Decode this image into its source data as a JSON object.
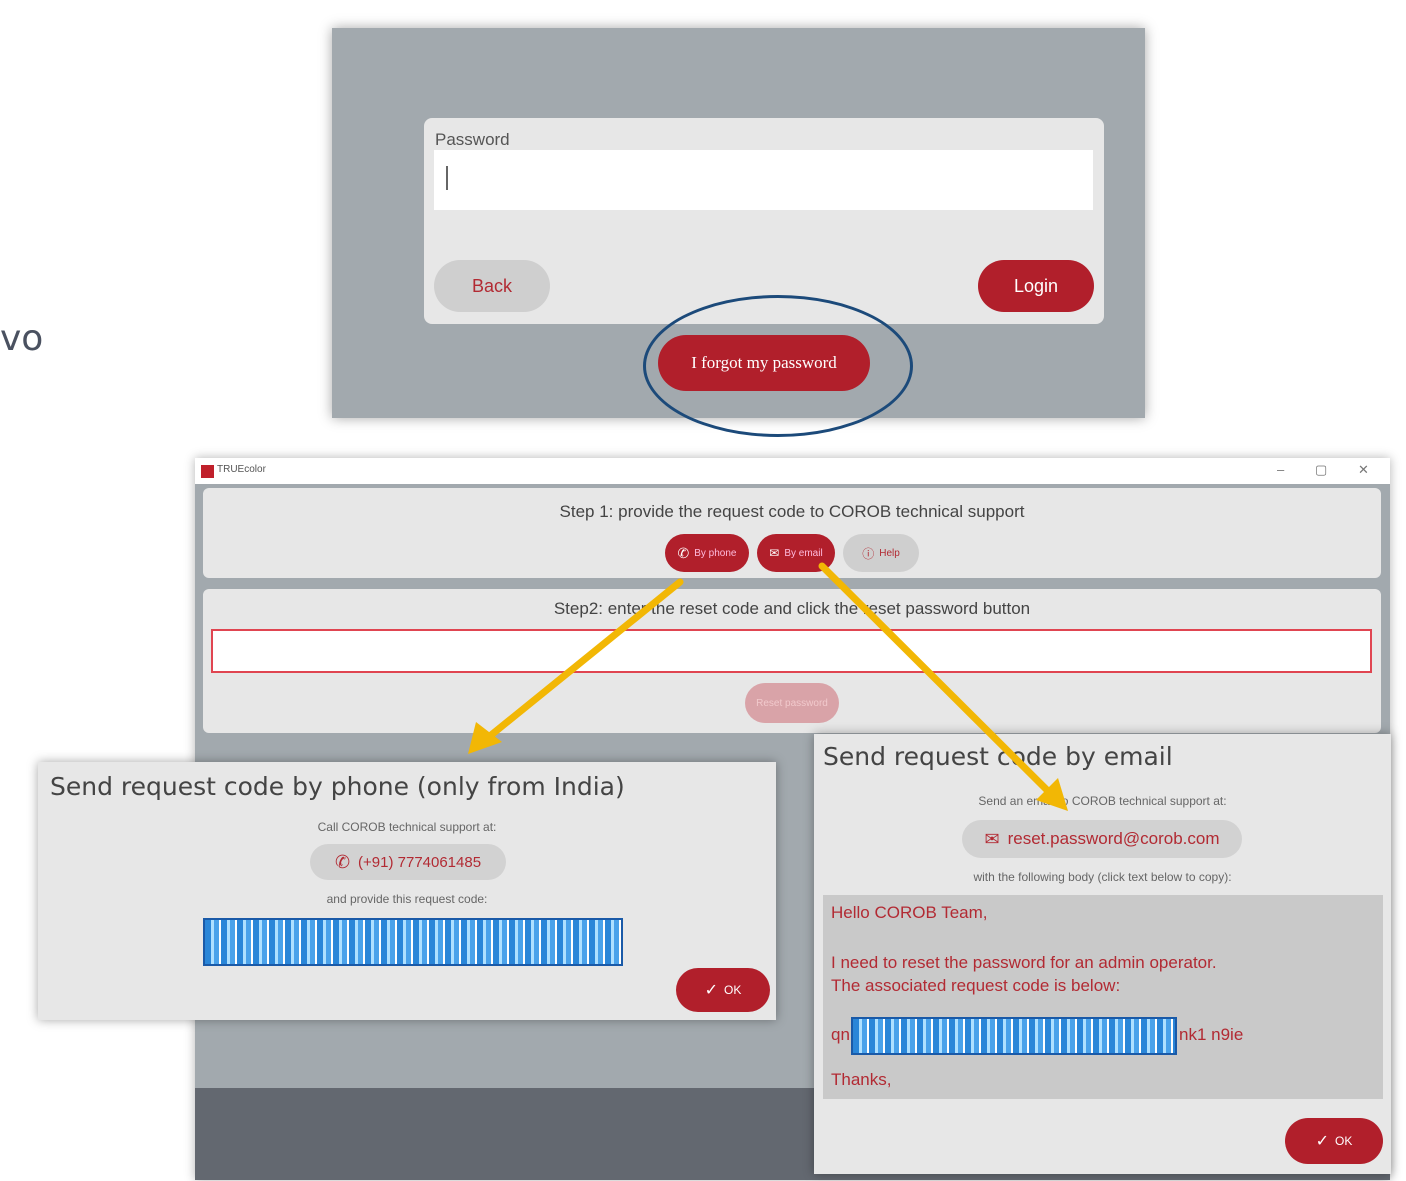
{
  "side_fragment": "vo",
  "login": {
    "password_label": "Password",
    "back_label": "Back",
    "login_label": "Login",
    "forgot_label": "I forgot my password"
  },
  "window": {
    "app_title": "TRUEcolor",
    "controls": {
      "minimize": "–",
      "maximize": "▢",
      "close": "✕"
    },
    "step1_title": "Step 1: provide the request code to COROB technical support",
    "step1_buttons": {
      "phone": "By phone",
      "email": "By email",
      "help": "Help"
    },
    "step2_title": "Step2: enter the reset code and click the reset password button",
    "reset_button": "Reset password"
  },
  "phone_dialog": {
    "title": "Send request code by phone (only from India)",
    "call_text": "Call COROB technical support at:",
    "phone_number": "(+91) 7774061485",
    "provide_text": "and provide this request code:",
    "ok_label": "OK"
  },
  "email_dialog": {
    "title": "Send request code by email",
    "send_text": "Send an email to COROB technical support at:",
    "email_address": "reset.password@corob.com",
    "body_hint": "with the following body (click text below to copy):",
    "body": {
      "greeting": "Hello COROB Team,",
      "line1": "I need to reset the password for an admin operator.",
      "line2": "The associated request code is below:",
      "code_prefix": "qn",
      "code_suffix": "nk1 n9ie",
      "closing": "Thanks,"
    },
    "ok_label": "OK"
  },
  "colors": {
    "accent_red": "#b11f2b",
    "highlight_circle": "#1c4a7a",
    "arrow": "#f2b705"
  }
}
